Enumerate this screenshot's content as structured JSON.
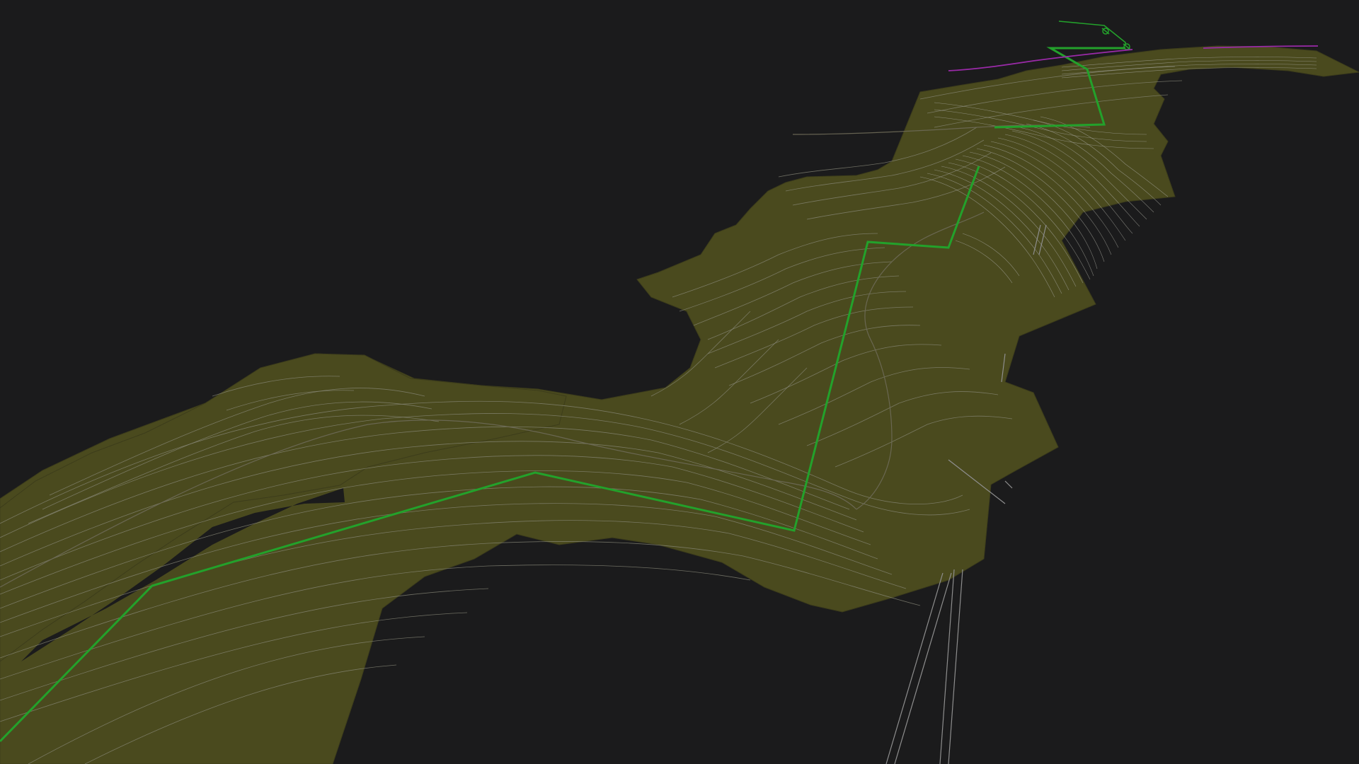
{
  "viewport": {
    "background_color": "#1b1b1c",
    "terrain_color": "#4a4a1e",
    "terrain_shadow_color": "#3d3d1b",
    "contour_color": "#8a8a7a",
    "contour_dense_color": "#a8a8a0",
    "road_color": "#6e6a58",
    "alignment_color": "#23a12b",
    "boundary_color": "#9a2aa8",
    "pipe_color": "#8e8e8e"
  },
  "annotations": {
    "small_label": ""
  }
}
